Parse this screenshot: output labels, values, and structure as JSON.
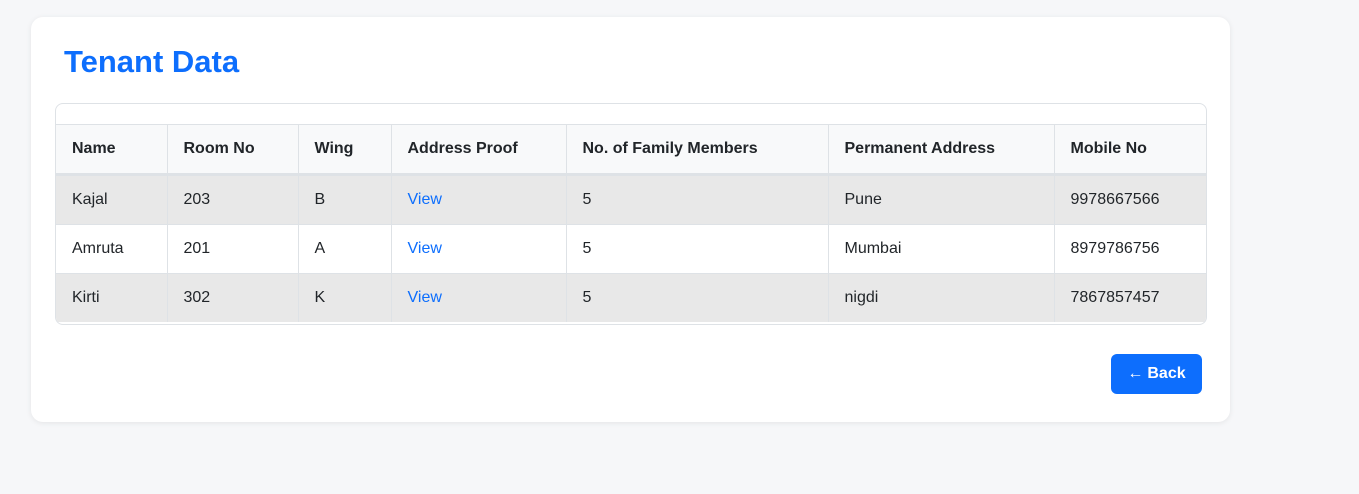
{
  "page": {
    "title": "Tenant Data"
  },
  "table": {
    "headers": [
      "Name",
      "Room No",
      "Wing",
      "Address Proof",
      "No. of Family Members",
      "Permanent Address",
      "Mobile No"
    ],
    "rows": [
      {
        "name": "Kajal",
        "room_no": "203",
        "wing": "B",
        "address_proof": "View",
        "family_members": "5",
        "permanent_address": "Pune",
        "mobile_no": "9978667566"
      },
      {
        "name": "Amruta",
        "room_no": "201",
        "wing": "A",
        "address_proof": "View",
        "family_members": "5",
        "permanent_address": "Mumbai",
        "mobile_no": "8979786756"
      },
      {
        "name": "Kirti",
        "room_no": "302",
        "wing": "K",
        "address_proof": "View",
        "family_members": "5",
        "permanent_address": "nigdi",
        "mobile_no": "7867857457"
      }
    ]
  },
  "actions": {
    "back_arrow": "←",
    "back_label": "Back"
  },
  "colors": {
    "accent": "#0d6efd",
    "stripe": "#e8e8e8",
    "header_bg": "#f8f9fa"
  }
}
